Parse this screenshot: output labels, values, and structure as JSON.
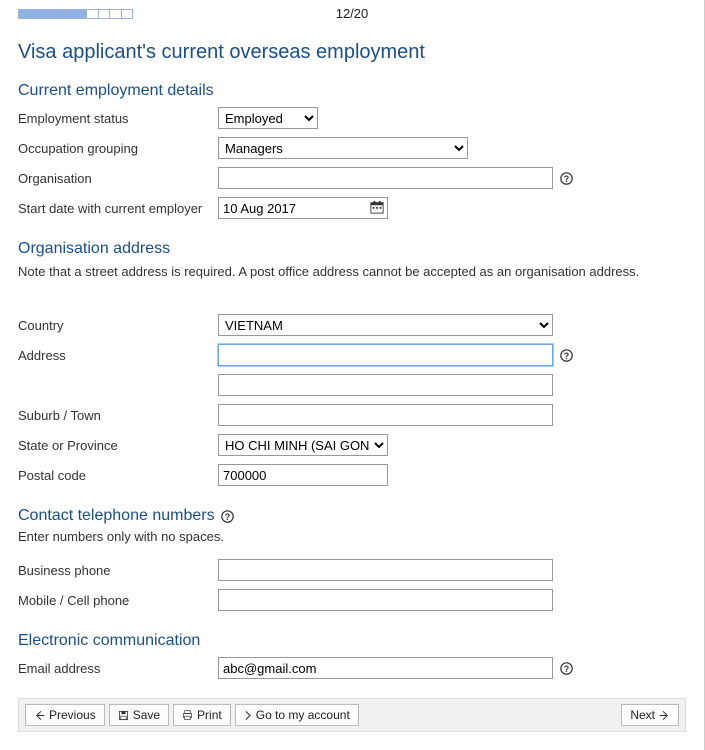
{
  "progress": {
    "step_label": "12/20",
    "percent": 60
  },
  "page_title": "Visa applicant's current overseas employment",
  "sections": {
    "employment": {
      "title": "Current employment details",
      "status_label": "Employment status",
      "status_value": "Employed",
      "occupation_label": "Occupation grouping",
      "occupation_value": "Managers",
      "organisation_label": "Organisation",
      "organisation_value": "",
      "start_date_label": "Start date with current employer",
      "start_date_value": "10 Aug 2017"
    },
    "address": {
      "title": "Organisation address",
      "note": "Note that a street address is required. A post office address cannot be accepted as an organisation address.",
      "country_label": "Country",
      "country_value": "VIETNAM",
      "address_label": "Address",
      "address_value1": "",
      "address_value2": "",
      "suburb_label": "Suburb / Town",
      "suburb_value": "",
      "state_label": "State or Province",
      "state_value": "HO CHI MINH (SAI GON)",
      "postal_label": "Postal code",
      "postal_value": "700000"
    },
    "phone": {
      "title": "Contact telephone numbers",
      "note": "Enter numbers only with no spaces.",
      "business_label": "Business phone",
      "business_value": "",
      "mobile_label": "Mobile / Cell phone",
      "mobile_value": ""
    },
    "email": {
      "title": "Electronic communication",
      "email_label": "Email address",
      "email_value": "abc@gmail.com"
    }
  },
  "buttons": {
    "previous": "Previous",
    "save": "Save",
    "print": "Print",
    "account": "Go to my account",
    "next": "Next"
  }
}
